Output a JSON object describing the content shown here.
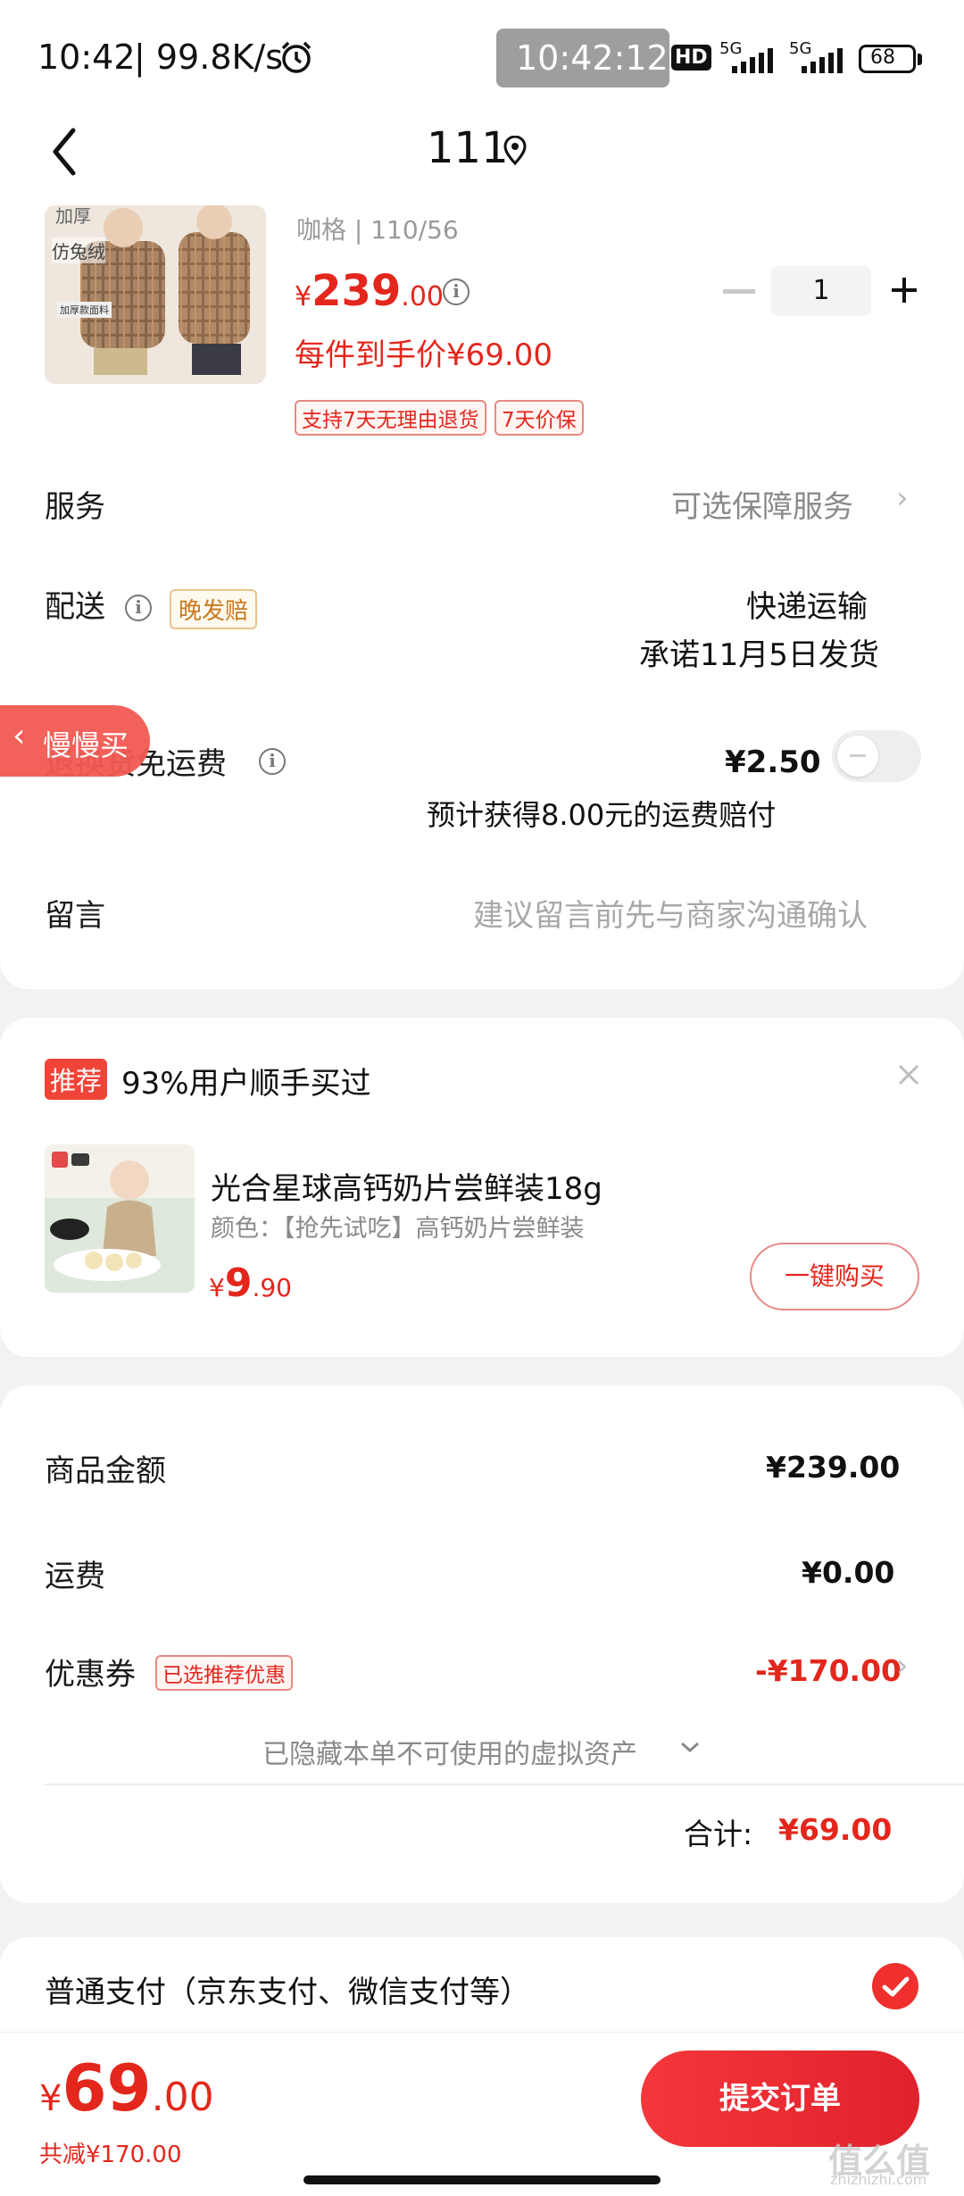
{
  "status_bar": {
    "time": "10:42",
    "speed": "| 99.8K/s",
    "center_time": "10:42:12",
    "hd": "HD",
    "net1": "5G",
    "net2": "5G",
    "battery": "68"
  },
  "header": {
    "title": "111"
  },
  "product": {
    "image_text_1": "加厚",
    "image_text_2": "仿兔绒",
    "image_text_3": "加厚款面料",
    "variant": "咖格 | 110/56",
    "price_symbol": "¥",
    "price_int": "239",
    "price_dec": ".00",
    "quantity": "1",
    "final_price": "每件到手价¥69.00",
    "tags": [
      "支持7天无理由退货",
      "7天价保"
    ]
  },
  "service": {
    "label": "服务",
    "value": "可选保障服务"
  },
  "delivery": {
    "label": "配送",
    "badge": "晚发赔",
    "method": "快递运输",
    "promise": "承诺11月5日发货"
  },
  "return_shipping": {
    "label": "退换货免运费",
    "price": "¥2.50",
    "note": "预计获得8.00元的运费赔付"
  },
  "floating_tab": {
    "label": "慢慢买"
  },
  "message": {
    "label": "留言",
    "placeholder": "建议留言前先与商家沟通确认"
  },
  "recommend": {
    "badge": "推荐",
    "title": "93%用户顺手买过",
    "product_name": "光合星球高钙奶片尝鲜装18g",
    "product_spec": "颜色：【抢先试吃】高钙奶片尝鲜装",
    "price_symbol": "¥",
    "price_int": "9",
    "price_dec": ".90",
    "buy_button": "一键购买"
  },
  "summary": {
    "goods_label": "商品金额",
    "goods_value": "¥239.00",
    "shipping_label": "运费",
    "shipping_value": "¥0.00",
    "coupon_label": "优惠券",
    "coupon_badge": "已选推荐优惠",
    "coupon_value": "-¥170.00",
    "hidden_assets": "已隐藏本单不可使用的虚拟资产",
    "total_label": "合计:",
    "total_value": "¥69.00"
  },
  "payment": {
    "label": "普通支付（京东支付、微信支付等）"
  },
  "bottom_bar": {
    "price_symbol": "¥",
    "price_int": "69",
    "price_dec": ".00",
    "discount": "共减¥170.00",
    "submit": "提交订单"
  },
  "watermark": {
    "text": "值么值",
    "url": "zhizhizhi.com"
  },
  "colors": {
    "accent": "#e3271d",
    "button_gradient_start": "#f5363a",
    "button_gradient_end": "#e0222d"
  }
}
